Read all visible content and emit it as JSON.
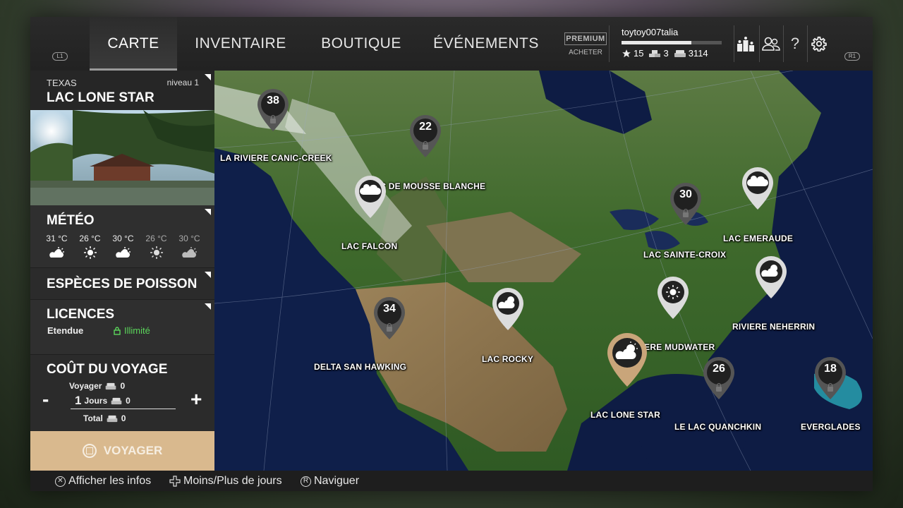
{
  "nav": {
    "tabs": [
      {
        "label": "CARTE",
        "active": true
      },
      {
        "label": "INVENTAIRE"
      },
      {
        "label": "BOUTIQUE"
      },
      {
        "label": "ÉVÉNEMENTS"
      }
    ],
    "l1": "L1",
    "r1": "R1"
  },
  "premium": {
    "badge": "PREMIUM",
    "action": "ACHETER"
  },
  "user": {
    "name": "toytoy007talia",
    "xp_fraction": 0.7,
    "stars": "15",
    "silver": "3",
    "credits": "3114"
  },
  "location": {
    "state": "TEXAS",
    "level": "niveau 1",
    "name": "LAC LONE STAR"
  },
  "meteo": {
    "title": "MÉTÉO",
    "days": [
      {
        "temp": "31 °C",
        "icon": "partly-sunny-icon"
      },
      {
        "temp": "26 °C",
        "icon": "sun-icon"
      },
      {
        "temp": "30 °C",
        "icon": "partly-sunny-icon"
      },
      {
        "temp": "26 °C",
        "icon": "sun-icon"
      },
      {
        "temp": "30 °C",
        "icon": "partly-sunny-icon"
      }
    ]
  },
  "species": {
    "title": "ESPÈCES DE POISSON"
  },
  "licences": {
    "title": "LICENCES",
    "label": "Etendue",
    "value": "Illimité"
  },
  "cost": {
    "title": "COÛT DU VOYAGE",
    "voyager_label": "Voyager",
    "voyager_value": "0",
    "days_count": "1",
    "days_label": "Jours",
    "days_value": "0",
    "total_label": "Total",
    "total_value": "0",
    "minus": "-",
    "plus": "+"
  },
  "travel_button": "VOYAGER",
  "map": {
    "locations": [
      {
        "name": "LA RIVIERE CANIC-CREEK",
        "level": "38",
        "locked": true,
        "weather": null
      },
      {
        "name": "LAC DE MOUSSE BLANCHE",
        "level": "22",
        "locked": true,
        "weather": null
      },
      {
        "name": "LAC FALCON",
        "level": null,
        "locked": false,
        "weather": "cloud-icon"
      },
      {
        "name": "LAC SAINTE-CROIX",
        "level": "30",
        "locked": true,
        "weather": null
      },
      {
        "name": "LAC EMERAUDE",
        "level": null,
        "locked": false,
        "weather": "cloud-icon"
      },
      {
        "name": "RIVIERE NEHERRIN",
        "level": null,
        "locked": false,
        "weather": "partly-sunny-icon"
      },
      {
        "name": "DELTA SAN HAWKING",
        "level": "34",
        "locked": true,
        "weather": null
      },
      {
        "name": "LAC ROCKY",
        "level": null,
        "locked": false,
        "weather": "partly-sunny-icon"
      },
      {
        "name": "RIVIERE MUDWATER",
        "level": null,
        "locked": false,
        "weather": "sun-icon"
      },
      {
        "name": "LAC LONE STAR",
        "level": null,
        "locked": false,
        "weather": "partly-sunny-icon",
        "selected": true
      },
      {
        "name": "LE LAC QUANCHKIN",
        "level": "26",
        "locked": true,
        "weather": null
      },
      {
        "name": "EVERGLADES",
        "level": "18",
        "locked": true,
        "weather": null
      }
    ]
  },
  "footer": {
    "hint1": "Afficher les infos",
    "hint2": "Moins/Plus de jours",
    "hint3": "Naviguer",
    "hint3_key": "R"
  }
}
